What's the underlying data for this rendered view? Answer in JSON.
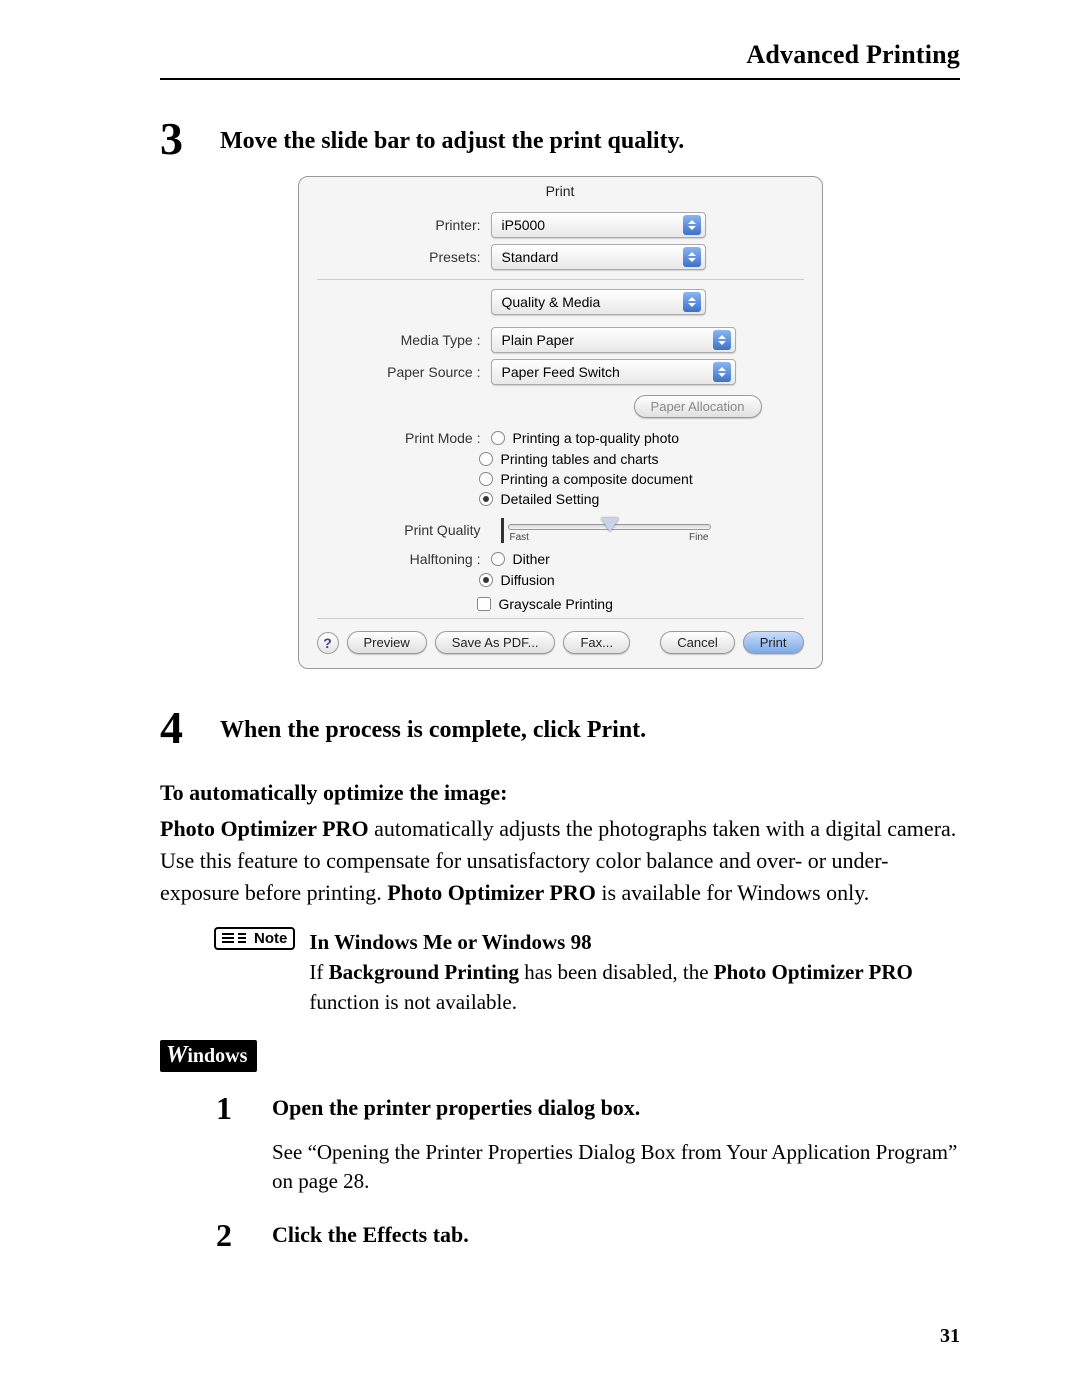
{
  "header": {
    "section_title": "Advanced Printing"
  },
  "step3": {
    "num": "3",
    "text": "Move the slide bar to adjust the print quality."
  },
  "dialog": {
    "title": "Print",
    "printer_label": "Printer:",
    "printer_value": "iP5000",
    "presets_label": "Presets:",
    "presets_value": "Standard",
    "panel_value": "Quality & Media",
    "media_type_label": "Media Type :",
    "media_type_value": "Plain Paper",
    "paper_source_label": "Paper Source :",
    "paper_source_value": "Paper Feed Switch",
    "paper_allocation": "Paper Allocation",
    "print_mode_label": "Print Mode :",
    "mode_top_quality": "Printing a top-quality photo",
    "mode_tables": "Printing tables and charts",
    "mode_composite": "Printing a composite document",
    "mode_detailed": "Detailed Setting",
    "print_quality_label": "Print Quality",
    "slider_fast": "Fast",
    "slider_fine": "Fine",
    "halftoning_label": "Halftoning :",
    "halftoning_dither": "Dither",
    "halftoning_diffusion": "Diffusion",
    "grayscale": "Grayscale Printing",
    "help": "?",
    "btn_preview": "Preview",
    "btn_save_pdf": "Save As PDF...",
    "btn_fax": "Fax...",
    "btn_cancel": "Cancel",
    "btn_print": "Print"
  },
  "step4": {
    "num": "4",
    "text_prefix": "When the process is complete, click ",
    "text_bold": "Print",
    "text_suffix": "."
  },
  "optimize": {
    "heading": "To automatically optimize the image:",
    "para_bold1": "Photo Optimizer PRO",
    "para_mid1": " automatically adjusts the photographs taken with a digital camera. Use this feature to compensate for unsatisfactory color balance and over- or under-exposure before printing. ",
    "para_bold2": "Photo Optimizer PRO",
    "para_mid2": " is available for Windows only."
  },
  "note": {
    "label": "Note",
    "heading": "In Windows Me or Windows 98",
    "line1a": "If ",
    "line1b": "Background Printing",
    "line1c": " has been disabled, the ",
    "line1d": "Photo Optimizer PRO",
    "line1e": " function is not available."
  },
  "windows_badge": "indows",
  "step1": {
    "num": "1",
    "text": "Open the printer properties dialog box.",
    "sub": "See “Opening the Printer Properties Dialog Box from Your Application Program” on page 28."
  },
  "step2": {
    "num": "2",
    "text_prefix": "Click the ",
    "text_bold": "Effects",
    "text_suffix": " tab."
  },
  "page_number": "31"
}
